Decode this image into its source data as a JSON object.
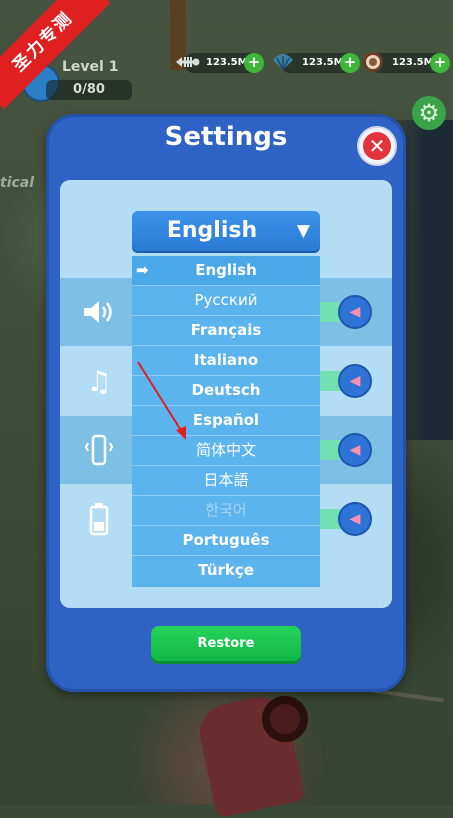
{
  "badge": {
    "text": "圣力专测"
  },
  "player": {
    "level_label": "Level 1",
    "progress_text": "0/80",
    "progress_fraction": 0
  },
  "resources": [
    {
      "icon": "fish-bone-icon",
      "value": "123.5M",
      "plus": "+"
    },
    {
      "icon": "shell-icon",
      "value": "123.5M",
      "plus": "+"
    },
    {
      "icon": "coconut-icon",
      "value": "123.5M",
      "plus": "+"
    }
  ],
  "background": {
    "partial_text": "tical"
  },
  "settings": {
    "title": "Settings",
    "close_label": "✕",
    "language": {
      "selected": "English",
      "caret": "▼",
      "options": [
        "English",
        "Русский",
        "Français",
        "Italiano",
        "Deutsch",
        "Español",
        "简体中文",
        "日本語",
        "한국어",
        "Português",
        "Türkçe"
      ]
    },
    "rows": [
      {
        "icon": "speaker-icon",
        "state": "on"
      },
      {
        "icon": "music-note-icon",
        "state": "on"
      },
      {
        "icon": "vibration-icon",
        "state": "on"
      },
      {
        "icon": "battery-icon",
        "state": "on"
      }
    ],
    "restore_label": "Restore"
  },
  "colors": {
    "dialog": "#2f62c5",
    "panel": "#b3ddf5",
    "dropdown": "#5bb4ee",
    "restore": "#10b543",
    "close": "#e0343a",
    "annotation": "#e02020"
  }
}
